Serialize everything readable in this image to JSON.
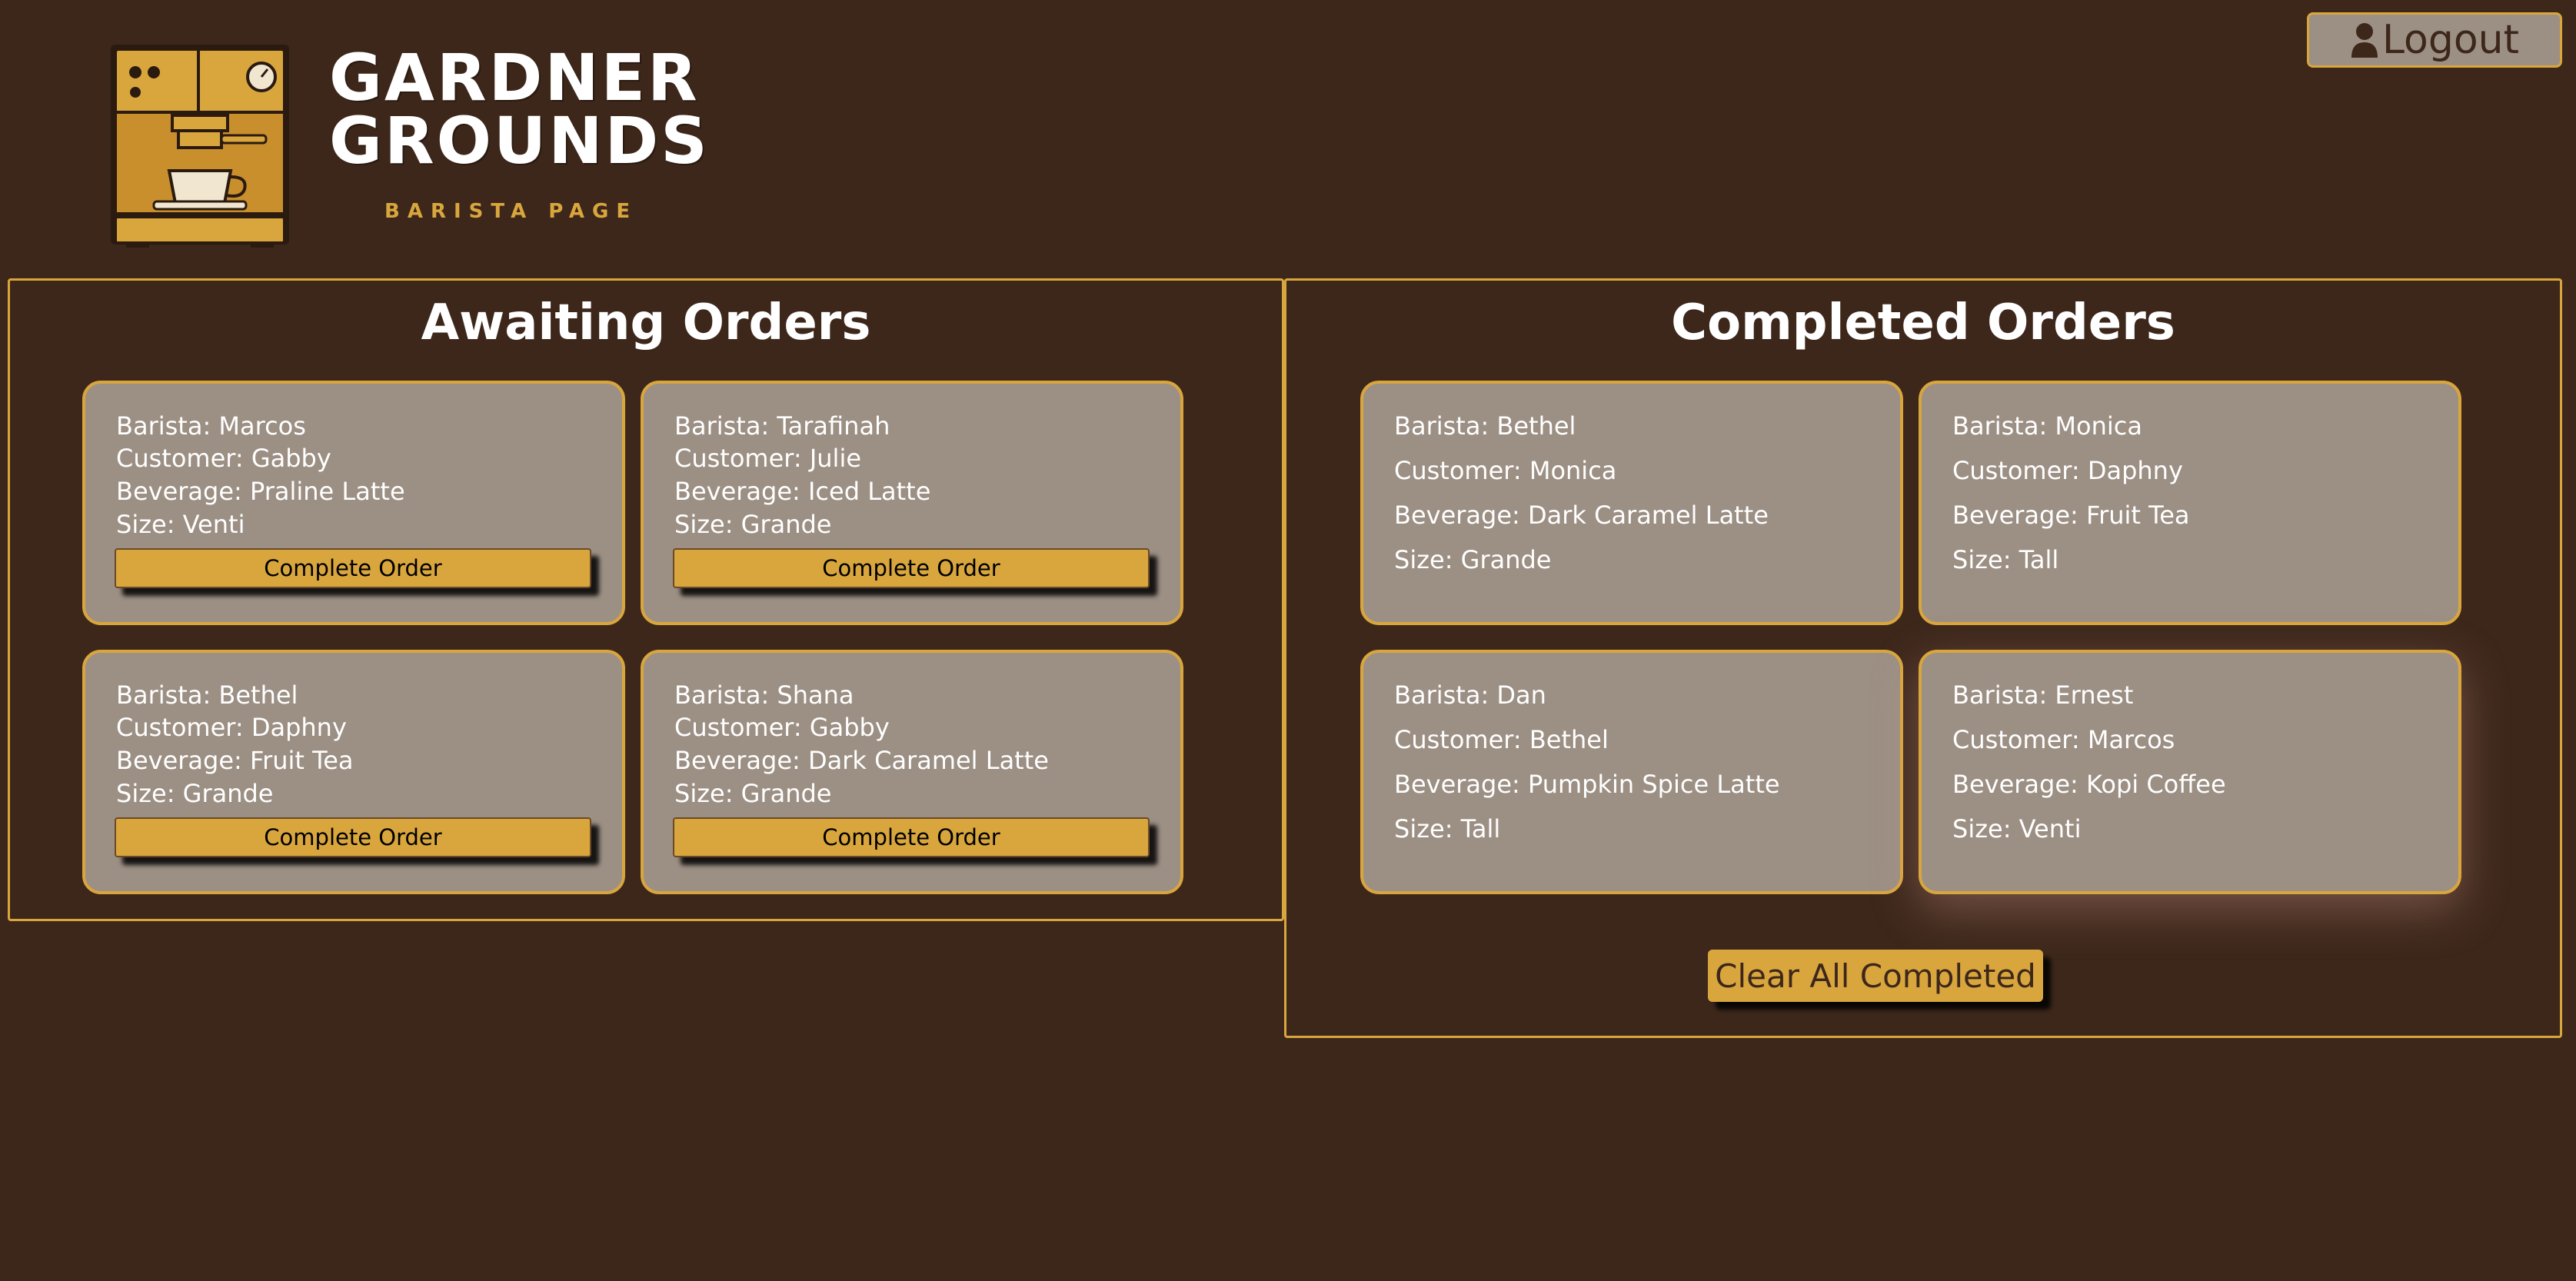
{
  "header": {
    "logout_label": "Logout",
    "logo_line1": "GARDNER",
    "logo_line2": "GROUNDS",
    "logo_subtitle": "BARISTA PAGE"
  },
  "awaiting": {
    "title": "Awaiting Orders",
    "button_label": "Complete Order",
    "orders": [
      {
        "barista": "Barista: Marcos",
        "customer": "Customer: Gabby",
        "beverage": "Beverage: Praline Latte",
        "size": "Size: Venti"
      },
      {
        "barista": "Barista: Tarafinah",
        "customer": "Customer: Julie",
        "beverage": "Beverage: Iced Latte",
        "size": "Size: Grande"
      },
      {
        "barista": "Barista: Bethel",
        "customer": "Customer: Daphny",
        "beverage": "Beverage: Fruit Tea",
        "size": "Size: Grande"
      },
      {
        "barista": "Barista: Shana",
        "customer": "Customer: Gabby",
        "beverage": "Beverage: Dark Caramel Latte",
        "size": "Size: Grande"
      }
    ]
  },
  "completed": {
    "title": "Completed Orders",
    "clear_label": "Clear All Completed",
    "orders": [
      {
        "barista": "Barista: Bethel",
        "customer": "Customer: Monica",
        "beverage": "Beverage: Dark Caramel Latte",
        "size": "Size: Grande"
      },
      {
        "barista": "Barista: Monica",
        "customer": "Customer: Daphny",
        "beverage": "Beverage: Fruit Tea",
        "size": "Size: Tall"
      },
      {
        "barista": "Barista: Dan",
        "customer": "Customer: Bethel",
        "beverage": "Beverage: Pumpkin Spice Latte",
        "size": "Size: Tall"
      },
      {
        "barista": "Barista: Ernest",
        "customer": "Customer: Marcos",
        "beverage": "Beverage: Kopi Coffee",
        "size": "Size: Venti"
      }
    ]
  },
  "colors": {
    "background": "#3d271b",
    "accent": "#d9a63d",
    "card": "#9c8f84"
  }
}
